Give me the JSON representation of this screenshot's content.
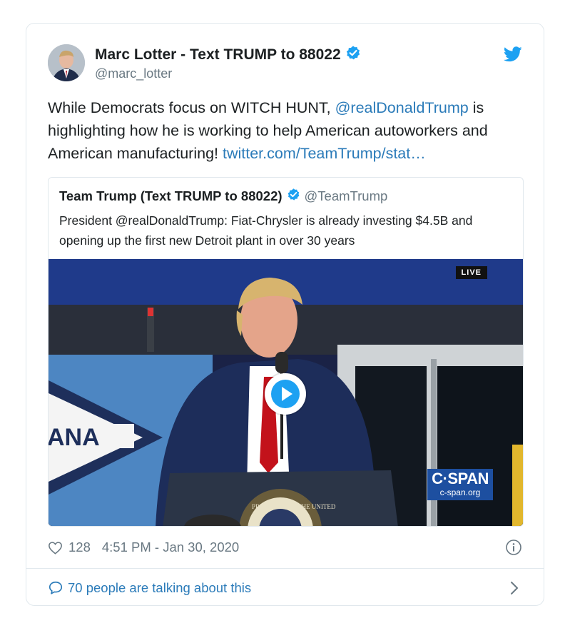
{
  "author": {
    "name": "Marc Lotter - Text TRUMP to 88022",
    "handle": "@marc_lotter"
  },
  "tweet": {
    "text_part1": "While Democrats focus on WITCH HUNT, ",
    "mention": "@realDonaldTrump",
    "text_part2": " is highlighting how he is working to help American autoworkers and American manufacturing! ",
    "link": "twitter.com/TeamTrump/stat…"
  },
  "quoted_tweet": {
    "name": "Team Trump (Text TRUMP to 88022)",
    "handle": "@TeamTrump",
    "text": "President @realDonaldTrump: Fiat-Chrysler is already investing $4.5B and opening up the first new Detroit plant in over 30 years",
    "video": {
      "live_badge": "LIVE",
      "sign_text": "ANA",
      "seal_text": "PRESIDENT OF THE UNITED",
      "cspan_logo": "C·SPAN",
      "cspan_url": "c-span.org"
    }
  },
  "footer": {
    "likes": "128",
    "timestamp": "4:51 PM - Jan 30, 2020",
    "talking": "70 people are talking about this"
  },
  "colors": {
    "accent": "#2b7bb9",
    "verified": "#1da1f2",
    "muted": "#697882",
    "border": "#e1e8ed"
  }
}
